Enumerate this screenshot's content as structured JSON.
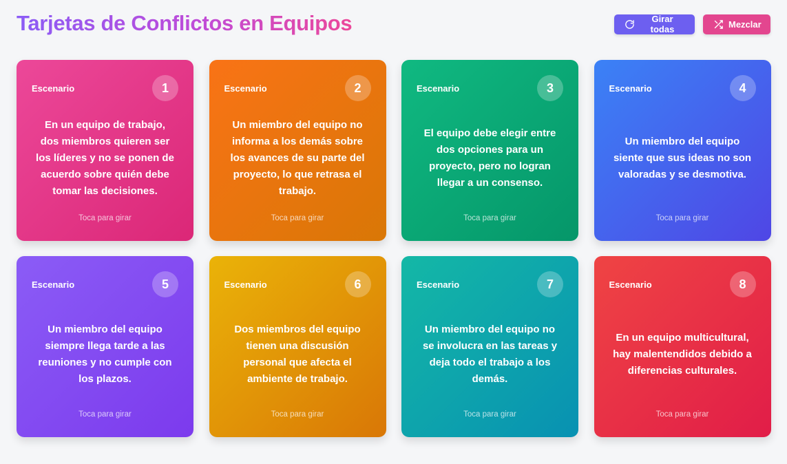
{
  "header": {
    "title": "Tarjetas de Conflictos en Equipos",
    "rotate_all_label": "Girar todas",
    "rotate_all_icon": "refresh-icon",
    "shuffle_label": "Mezclar",
    "shuffle_icon": "shuffle-icon"
  },
  "cards": [
    {
      "label": "Escenario",
      "number": "1",
      "text": "En un equipo de trabajo, dos miembros quieren ser los líderes y no se ponen de acuerdo sobre quién debe tomar las decisiones.",
      "hint": "Toca para girar",
      "gradient": [
        "#ec4899",
        "#db2777"
      ]
    },
    {
      "label": "Escenario",
      "number": "2",
      "text": "Un miembro del equipo no informa a los demás sobre los avances de su parte del proyecto, lo que retrasa el trabajo.",
      "hint": "Toca para girar",
      "gradient": [
        "#f97316",
        "#d97706"
      ]
    },
    {
      "label": "Escenario",
      "number": "3",
      "text": "El equipo debe elegir entre dos opciones para un proyecto, pero no logran llegar a un consenso.",
      "hint": "Toca para girar",
      "gradient": [
        "#10b981",
        "#059669"
      ]
    },
    {
      "label": "Escenario",
      "number": "4",
      "text": "Un miembro del equipo siente que sus ideas no son valoradas y se desmotiva.",
      "hint": "Toca para girar",
      "gradient": [
        "#3b82f6",
        "#4f46e5"
      ]
    },
    {
      "label": "Escenario",
      "number": "5",
      "text": "Un miembro del equipo siempre llega tarde a las reuniones y no cumple con los plazos.",
      "hint": "Toca para girar",
      "gradient": [
        "#8b5cf6",
        "#7c3aed"
      ]
    },
    {
      "label": "Escenario",
      "number": "6",
      "text": "Dos miembros del equipo tienen una discusión personal que afecta el ambiente de trabajo.",
      "hint": "Toca para girar",
      "gradient": [
        "#eab308",
        "#d97706"
      ]
    },
    {
      "label": "Escenario",
      "number": "7",
      "text": "Un miembro del equipo no se involucra en las tareas y deja todo el trabajo a los demás.",
      "hint": "Toca para girar",
      "gradient": [
        "#14b8a6",
        "#0891b2"
      ]
    },
    {
      "label": "Escenario",
      "number": "8",
      "text": "En un equipo multicultural, hay malentendidos debido a diferencias culturales.",
      "hint": "Toca para girar",
      "gradient": [
        "#ef4444",
        "#e11d48"
      ]
    }
  ]
}
